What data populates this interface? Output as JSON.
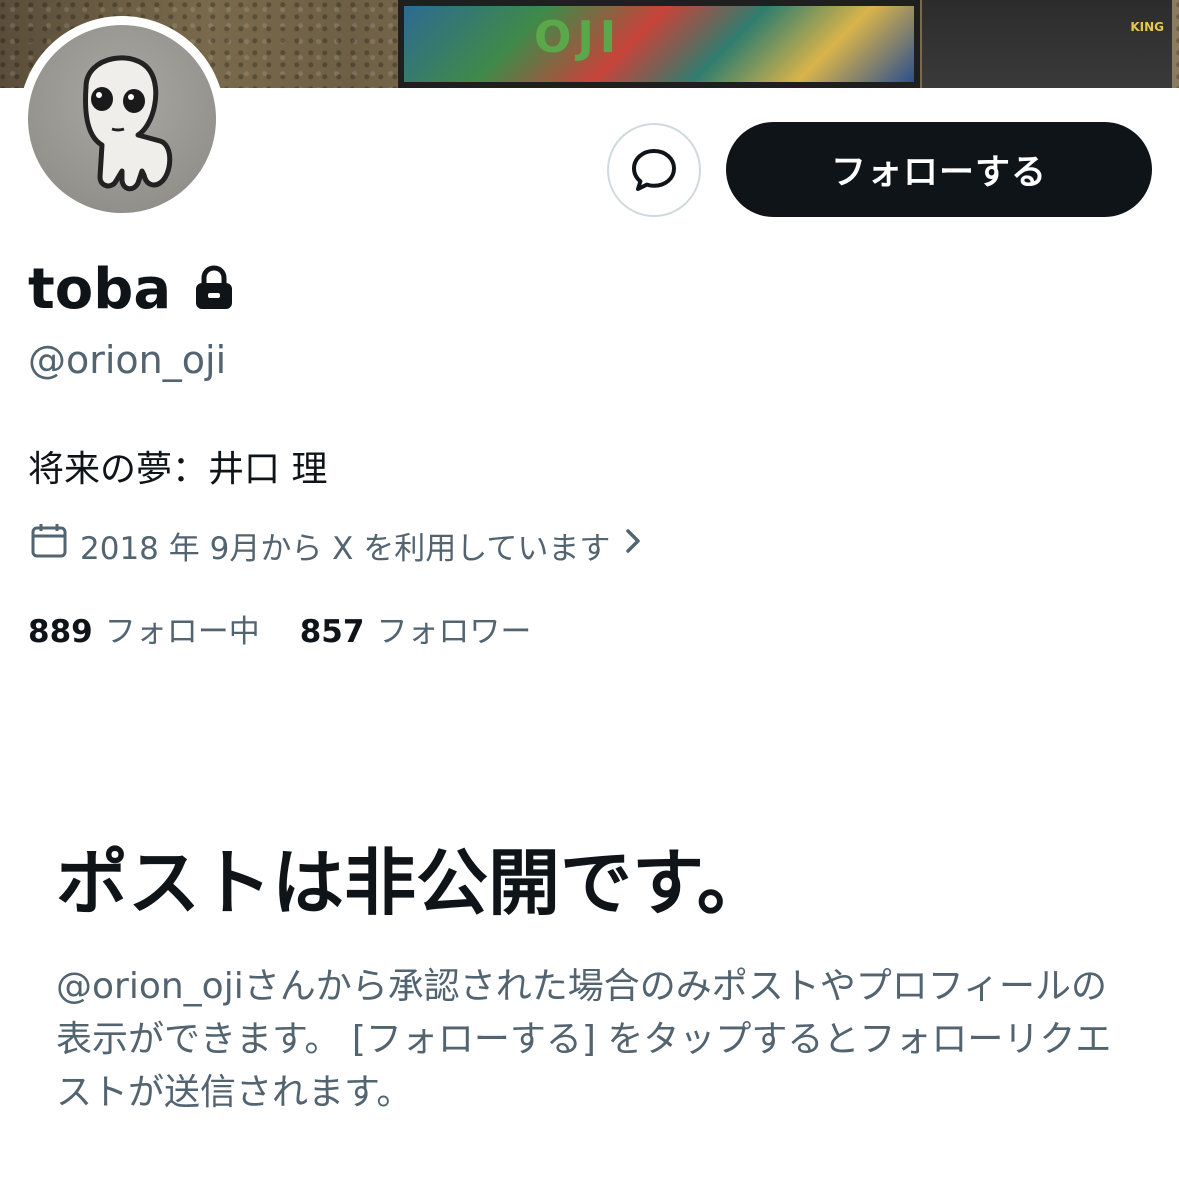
{
  "banner": {
    "album_text": "OJI",
    "side_text": "KING"
  },
  "profile": {
    "display_name": "toba",
    "handle": "@orion_oji",
    "bio": "将来の夢：井口 理",
    "joined": "2018 年 9月から X を利用しています"
  },
  "actions": {
    "follow_label": "フォローする"
  },
  "stats": {
    "following_count": "889",
    "following_label": "フォロー中",
    "followers_count": "857",
    "followers_label": "フォロワー"
  },
  "private_notice": {
    "title": "ポストは非公開です。",
    "description": "@orion_ojiさんから承認された場合のみポストやプロフィールの表示ができます。 [フォローする] をタップするとフォローリクエストが送信されます。"
  },
  "icons": {
    "message": "message-icon",
    "lock": "lock-icon",
    "calendar": "calendar-icon",
    "chevron": "chevron-right-icon"
  },
  "colors": {
    "text_primary": "#0f1419",
    "text_secondary": "#536471",
    "border": "#cfd9de",
    "button_bg": "#0f1419"
  }
}
